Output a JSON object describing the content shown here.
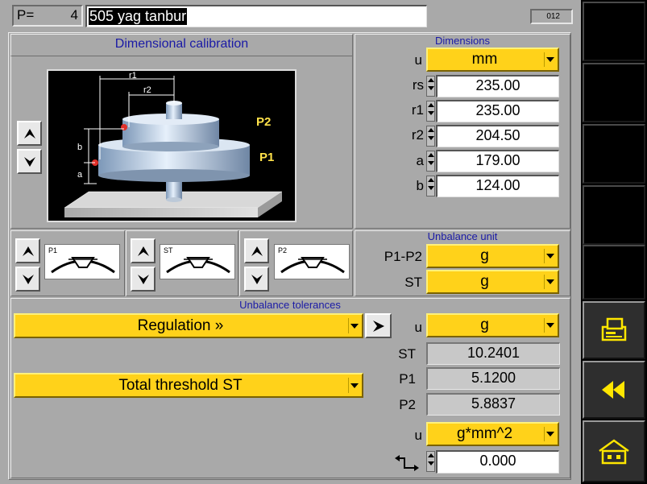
{
  "header": {
    "program_label": "P=",
    "program_number": "4",
    "program_name": "505 yag tanbur",
    "screen_code": "012"
  },
  "calibration": {
    "title": "Dimensional calibration",
    "image_labels": {
      "r1": "r1",
      "r2": "r2",
      "b": "b",
      "a": "a",
      "p1": "P1",
      "p2": "P2"
    }
  },
  "dimensions": {
    "title": "Dimensions",
    "unit_label": "u",
    "unit_value": "mm",
    "rows": [
      {
        "label": "rs",
        "value": "235.00"
      },
      {
        "label": "r1",
        "value": "235.00"
      },
      {
        "label": "r2",
        "value": "204.50"
      },
      {
        "label": "a",
        "value": "179.00"
      },
      {
        "label": "b",
        "value": "124.00"
      }
    ]
  },
  "planes": [
    {
      "label": "P1"
    },
    {
      "label": "ST"
    },
    {
      "label": "P2"
    }
  ],
  "unbalance_unit": {
    "title": "Unbalance unit",
    "rows": [
      {
        "label": "P1-P2",
        "value": "g"
      },
      {
        "label": "ST",
        "value": "g"
      }
    ]
  },
  "tolerances": {
    "title": "Unbalance tolerances",
    "regulation": "Regulation  »",
    "threshold": "Total threshold ST",
    "unit_label": "u",
    "unit_value": "g",
    "values": [
      {
        "label": "ST",
        "value": "10.2401"
      },
      {
        "label": "P1",
        "value": "5.1200"
      },
      {
        "label": "P2",
        "value": "5.8837"
      }
    ],
    "moment_unit_label": "u",
    "moment_unit_value": "g*mm^2",
    "offset_value": "0.000"
  },
  "colors": {
    "accent_yellow": "#ffd21a",
    "title_blue": "#1a1aa6",
    "panel_gray": "#a9a9a9"
  },
  "icons": {
    "print": "printer-icon",
    "back": "rewind-icon",
    "home": "home-icon"
  }
}
